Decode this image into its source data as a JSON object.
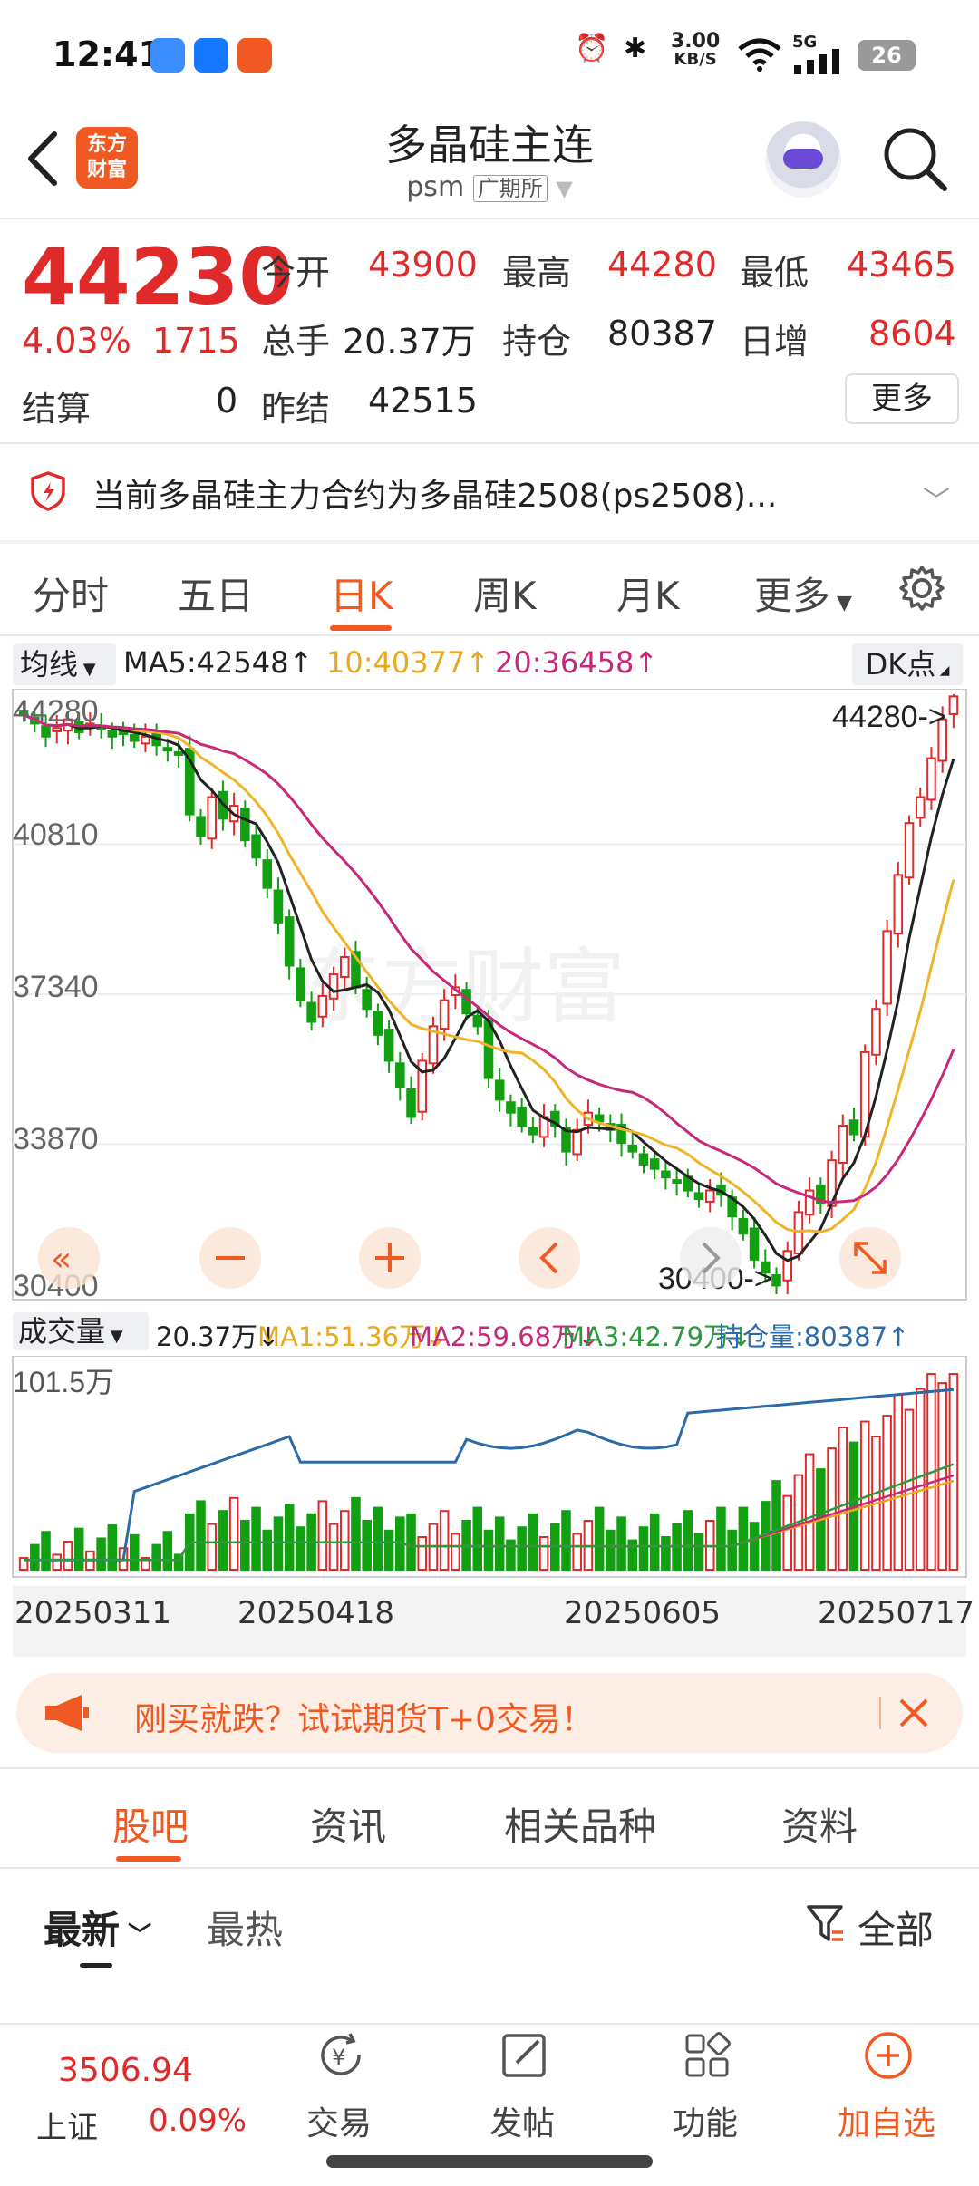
{
  "status": {
    "time": "12:41",
    "net_speed_value": "3.00",
    "net_speed_unit": "KB/S",
    "signal": "5G",
    "battery": "26"
  },
  "header": {
    "logo_line1": "东方",
    "logo_line2": "财富",
    "title": "多晶硅主连",
    "code": "psm",
    "exchange": "广期所"
  },
  "quote": {
    "price": "44230",
    "change_pct": "4.03%",
    "change": "1715",
    "open_label": "今开",
    "open": "43900",
    "high_label": "最高",
    "high": "44280",
    "low_label": "最低",
    "low": "43465",
    "volume_label": "总手",
    "volume": "20.37万",
    "oi_label": "持仓",
    "oi": "80387",
    "oi_change_label": "日增",
    "oi_change": "8604",
    "settle_label": "结算",
    "settle": "0",
    "prev_settle_label": "昨结",
    "prev_settle": "42515",
    "more_label": "更多"
  },
  "notice": {
    "text": "当前多晶硅主力合约为多晶硅2508(ps2508)..."
  },
  "tabs": [
    "分时",
    "五日",
    "日K",
    "周K",
    "月K",
    "更多"
  ],
  "ma": {
    "select": "均线",
    "ma5": "MA5:42548↑",
    "ma10": "10:40377↑",
    "ma20": "20:36458↑",
    "dk": "DK点",
    "colors": {
      "ma5": "#222222",
      "ma10": "#f0b428",
      "ma20": "#c8287a"
    }
  },
  "kline": {
    "y_labels": [
      "44280",
      "40810",
      "37340",
      "33870",
      "30400"
    ],
    "max_tag": "44280->",
    "min_tag": "30400->",
    "watermark": "东方财富"
  },
  "volume": {
    "select": "成交量",
    "vol": "20.37万↓",
    "ma1": "MA1:51.36万↓",
    "ma2": "MA2:59.68万↓",
    "ma3": "MA3:42.79万↓",
    "oi": "持仓量:80387↑",
    "y_max": "101.5万"
  },
  "dates": [
    "20250311",
    "20250418",
    "20250605",
    "20250717"
  ],
  "promo": {
    "text": "刚买就跌？试试期货T+0交易！"
  },
  "bottom_tabs": [
    "股吧",
    "资讯",
    "相关品种",
    "资料"
  ],
  "sort": {
    "latest": "最新",
    "hot": "最热",
    "filter": "全部"
  },
  "nav": {
    "index_value": "3506.94",
    "index_name": "上证",
    "index_change": "0.09%",
    "items": [
      "交易",
      "发帖",
      "功能",
      "加自选"
    ]
  },
  "chart_data": {
    "type": "candlestick",
    "series_hint": "daily K-line, price axis 30400–44280",
    "ylim": [
      30400,
      44280
    ],
    "x_ticks": [
      "20250311",
      "20250418",
      "20250605",
      "20250717"
    ],
    "closes": [
      43800,
      43600,
      43300,
      43500,
      43700,
      43400,
      43600,
      43500,
      43300,
      43400,
      43200,
      43300,
      43100,
      43000,
      42900,
      41500,
      41000,
      41900,
      41400,
      41700,
      40900,
      40500,
      39800,
      39000,
      38000,
      37200,
      36700,
      37300,
      37800,
      38200,
      37500,
      37000,
      36400,
      35800,
      35200,
      34500,
      35800,
      36600,
      37200,
      37500,
      36900,
      36600,
      35400,
      34900,
      34600,
      34300,
      34100,
      34500,
      34300,
      33700,
      34200,
      34600,
      34400,
      34200,
      33900,
      33700,
      33400,
      33300,
      33100,
      33000,
      32800,
      32600,
      32800,
      32700,
      32200,
      31800,
      31200,
      30900,
      30600,
      31400,
      32300,
      32800,
      32500,
      33500,
      34300,
      34100,
      36000,
      37000,
      38800,
      40100,
      41300,
      41900,
      42800,
      43700,
      44230
    ]
  }
}
